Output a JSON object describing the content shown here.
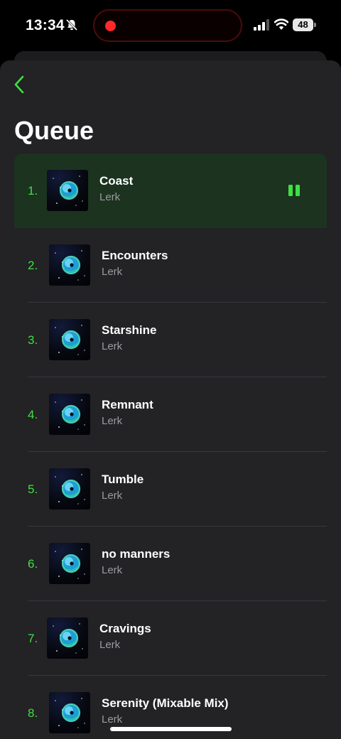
{
  "status_bar": {
    "time": "13:34",
    "battery": "48",
    "icons": [
      "bell-slash-icon",
      "recording-dot-icon",
      "signal-icon",
      "wifi-icon",
      "battery-icon"
    ]
  },
  "nav": {
    "back_icon": "chevron-left-icon"
  },
  "page": {
    "title": "Queue"
  },
  "queue": [
    {
      "index": "1.",
      "title": "Coast",
      "artist": "Lerk",
      "playing": true
    },
    {
      "index": "2.",
      "title": "Encounters",
      "artist": "Lerk"
    },
    {
      "index": "3.",
      "title": "Starshine",
      "artist": "Lerk"
    },
    {
      "index": "4.",
      "title": "Remnant",
      "artist": "Lerk"
    },
    {
      "index": "5.",
      "title": "Tumble",
      "artist": "Lerk"
    },
    {
      "index": "6.",
      "title": "no manners",
      "artist": "Lerk"
    },
    {
      "index": "7.",
      "title": "Cravings",
      "artist": "Lerk"
    },
    {
      "index": "8.",
      "title": "Serenity (Mixable Mix)",
      "artist": "Lerk"
    }
  ],
  "colors": {
    "accent": "#3ee042",
    "background": "#232225",
    "active_row": "#1c3320",
    "secondary_text": "#9b9aa0"
  }
}
